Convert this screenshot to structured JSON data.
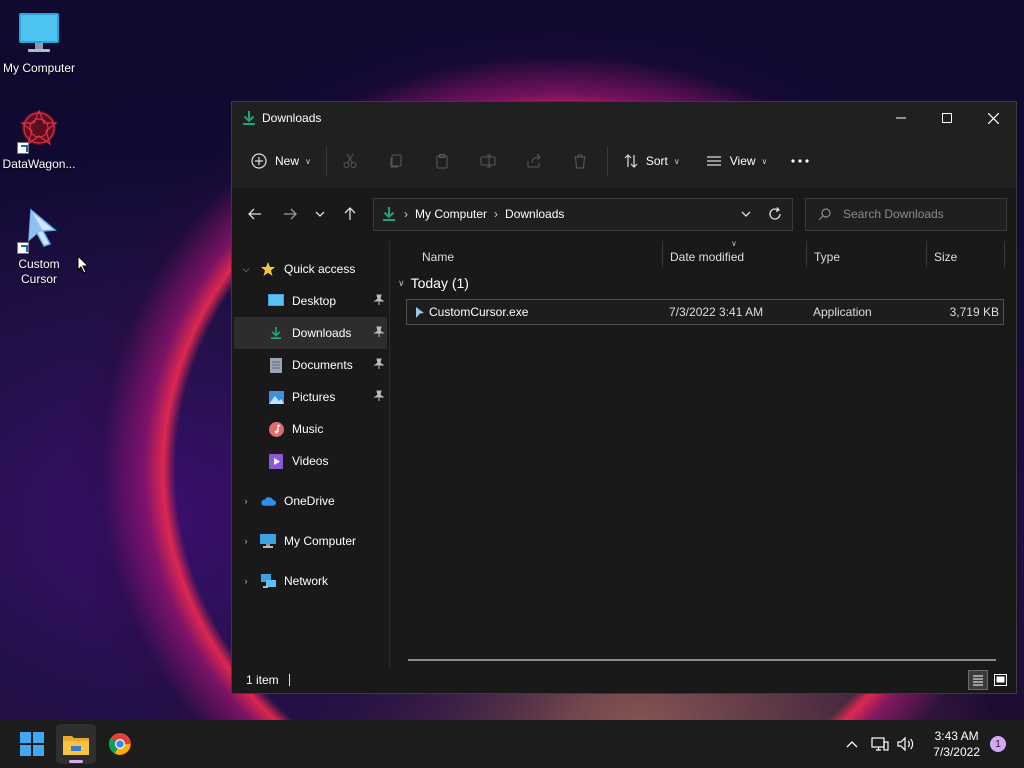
{
  "desktop": {
    "icons": [
      {
        "label": "My Computer"
      },
      {
        "label": "DataWagon..."
      },
      {
        "label": "Custom Cursor"
      }
    ]
  },
  "window": {
    "title": "Downloads",
    "toolbar": {
      "new_label": "New",
      "sort_label": "Sort",
      "view_label": "View"
    },
    "address": {
      "crumbs": [
        "My Computer",
        "Downloads"
      ]
    },
    "search": {
      "placeholder": "Search Downloads"
    },
    "nav": {
      "quick_access": "Quick access",
      "items": [
        {
          "label": "Desktop"
        },
        {
          "label": "Downloads"
        },
        {
          "label": "Documents"
        },
        {
          "label": "Pictures"
        },
        {
          "label": "Music"
        },
        {
          "label": "Videos"
        }
      ],
      "onedrive": "OneDrive",
      "my_computer": "My Computer",
      "network": "Network"
    },
    "columns": {
      "name": "Name",
      "date": "Date modified",
      "type": "Type",
      "size": "Size"
    },
    "group": {
      "label": "Today (1)"
    },
    "files": [
      {
        "name": "CustomCursor.exe",
        "date": "7/3/2022 3:41 AM",
        "type": "Application",
        "size": "3,719 KB"
      }
    ],
    "status": {
      "count": "1 item"
    }
  },
  "taskbar": {
    "time": "3:43 AM",
    "date": "7/3/2022",
    "notifications": "1"
  },
  "colors": {
    "accent_green": "#1fa37a",
    "folder_yellow": "#f5c542",
    "badge": "#d6a8f3"
  }
}
